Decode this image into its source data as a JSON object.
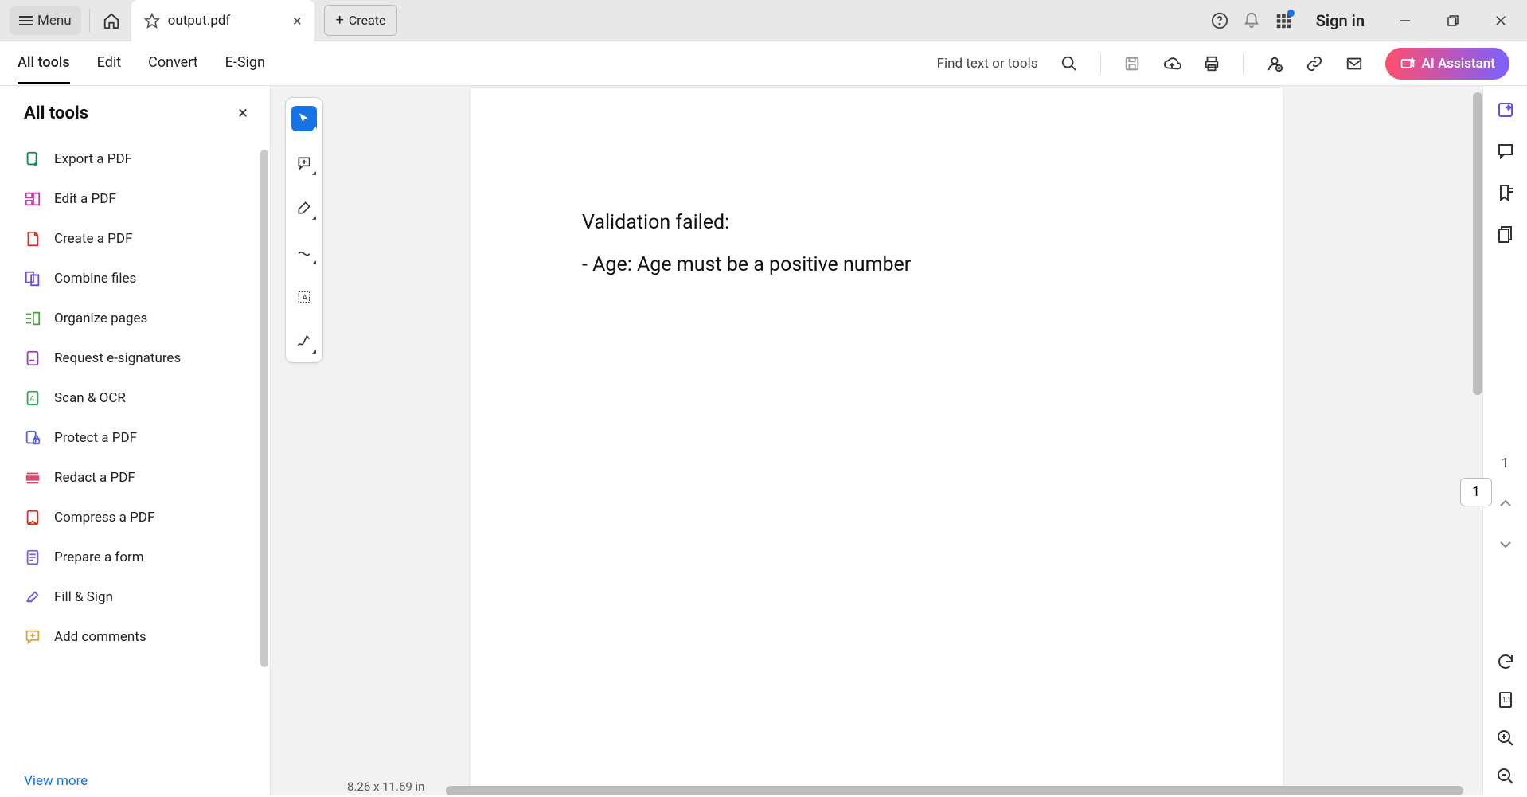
{
  "titlebar": {
    "menu_label": "Menu",
    "tab_title": "output.pdf",
    "create_label": "Create",
    "signin_label": "Sign in"
  },
  "toolbar": {
    "tabs": [
      "All tools",
      "Edit",
      "Convert",
      "E-Sign"
    ],
    "active_tab": 0,
    "find_label": "Find text or tools",
    "ai_label": "AI Assistant"
  },
  "sidebar": {
    "title": "All tools",
    "items": [
      {
        "label": "Export a PDF",
        "icon_color": "#0f8a57"
      },
      {
        "label": "Edit a PDF",
        "icon_color": "#c23aa8"
      },
      {
        "label": "Create a PDF",
        "icon_color": "#d93025"
      },
      {
        "label": "Combine files",
        "icon_color": "#6c4fd8"
      },
      {
        "label": "Organize pages",
        "icon_color": "#4aa33e"
      },
      {
        "label": "Request e-signatures",
        "icon_color": "#a03ab7"
      },
      {
        "label": "Scan & OCR",
        "icon_color": "#36a853"
      },
      {
        "label": "Protect a PDF",
        "icon_color": "#5b62d6"
      },
      {
        "label": "Redact a PDF",
        "icon_color": "#d84b6a"
      },
      {
        "label": "Compress a PDF",
        "icon_color": "#d93025"
      },
      {
        "label": "Prepare a form",
        "icon_color": "#7b5fd9"
      },
      {
        "label": "Fill & Sign",
        "icon_color": "#7b5fd9"
      },
      {
        "label": "Add comments",
        "icon_color": "#d8a53a"
      }
    ],
    "view_more": "View more"
  },
  "float_tools": {
    "items": [
      "select-tool",
      "comment-tool",
      "highlight-tool",
      "draw-tool",
      "text-select-tool",
      "sign-tool"
    ]
  },
  "document": {
    "heading": "Validation failed:",
    "line1": "- Age: Age must be a positive number",
    "page_size": "8.26 x 11.69 in"
  },
  "page_nav": {
    "current": "1",
    "total": "1"
  }
}
